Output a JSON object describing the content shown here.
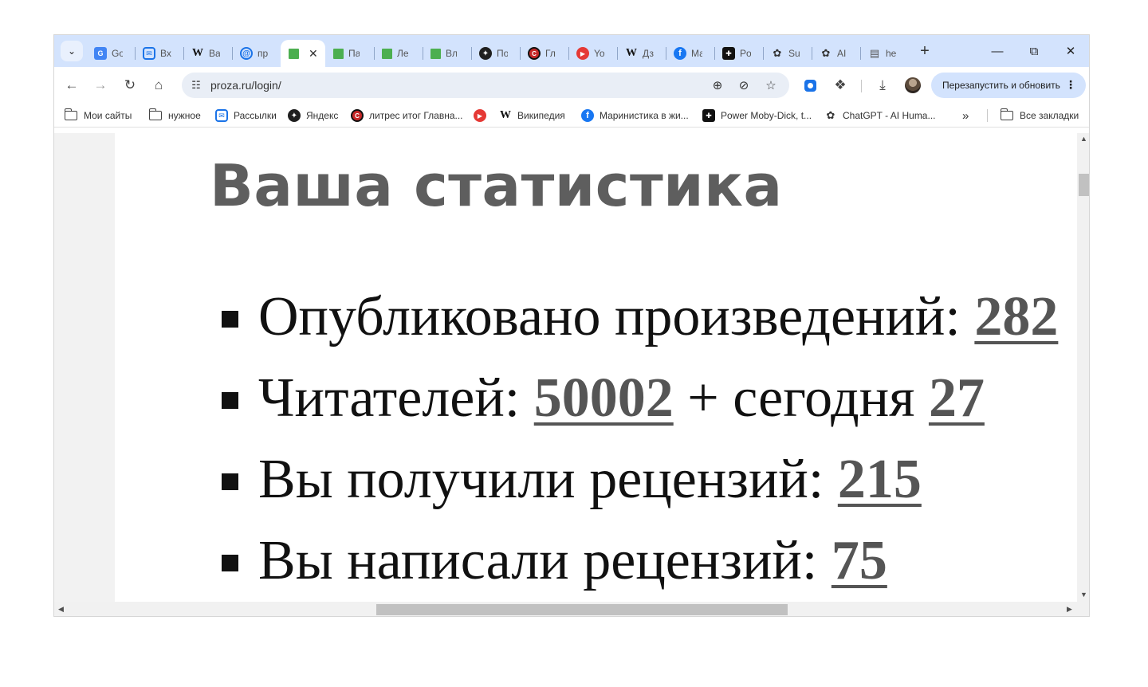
{
  "tabs": [
    {
      "icon": "google-translate-icon",
      "title": "Go"
    },
    {
      "icon": "mail-icon",
      "title": "Вх"
    },
    {
      "icon": "wikipedia-icon",
      "title": "Ва"
    },
    {
      "icon": "at-sign-icon",
      "title": "пр"
    },
    {
      "icon": "green-square-icon",
      "title": "",
      "active": true
    },
    {
      "icon": "green-square-icon",
      "title": "Па"
    },
    {
      "icon": "green-square-icon",
      "title": "Ле"
    },
    {
      "icon": "green-square-icon",
      "title": "Вл"
    },
    {
      "icon": "sparkle-icon",
      "title": "По"
    },
    {
      "icon": "litres-icon",
      "title": "Гл"
    },
    {
      "icon": "youtube-icon",
      "title": "Yo"
    },
    {
      "icon": "wikipedia-icon",
      "title": "Дз"
    },
    {
      "icon": "facebook-icon",
      "title": "Ма"
    },
    {
      "icon": "power-icon",
      "title": "Po"
    },
    {
      "icon": "chatgpt-icon",
      "title": "Su"
    },
    {
      "icon": "chatgpt-icon",
      "title": "AI"
    },
    {
      "icon": "book-icon",
      "title": "he"
    }
  ],
  "toolbar": {
    "url": "proza.ru/login/",
    "relaunch_label": "Перезапустить и обновить"
  },
  "bookmarks": {
    "items": [
      {
        "label": "Мои сайты",
        "icon": "folder-icon"
      },
      {
        "label": "нужное",
        "icon": "folder-icon"
      },
      {
        "label": "Рассылки",
        "icon": "mail-icon"
      },
      {
        "label": "Яндекс",
        "icon": "sparkle-icon"
      },
      {
        "label": "литрес итог Главна...",
        "icon": "litres-icon"
      },
      {
        "label": "",
        "icon": "youtube-icon"
      },
      {
        "label": "Википедия",
        "icon": "wikipedia-icon"
      },
      {
        "label": "Маринистика в жи...",
        "icon": "facebook-icon"
      },
      {
        "label": "Power Moby-Dick, t...",
        "icon": "power-icon"
      },
      {
        "label": "ChatGPT - AI Huma...",
        "icon": "chatgpt-icon"
      }
    ],
    "all_bookmarks": "Все закладки"
  },
  "content": {
    "title": "Ваша статистика",
    "stats": [
      {
        "label": "Опубликовано произведений: ",
        "value": "282"
      },
      {
        "label": "Читателей: ",
        "value": "50002",
        "middle": " + сегодня ",
        "value2": "27"
      },
      {
        "label": "Вы получили рецензий: ",
        "value": "215"
      },
      {
        "label": "Вы написали рецензий: ",
        "value": "75"
      }
    ]
  },
  "colors": {
    "tabstrip_bg": "#d3e3fd",
    "title_color": "#5e5e5e",
    "value_color": "#555555"
  }
}
